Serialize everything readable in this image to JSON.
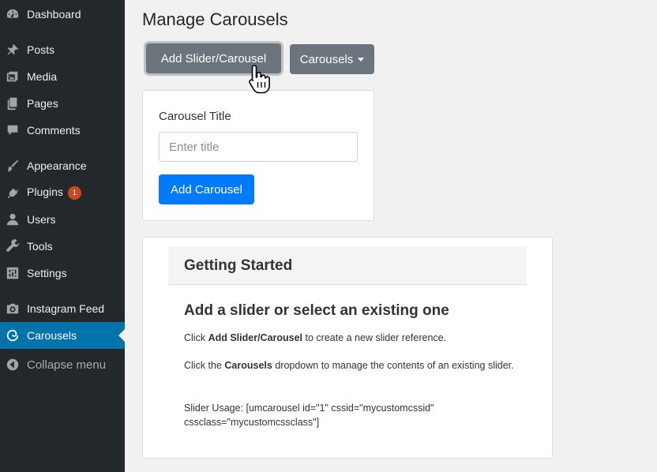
{
  "sidebar": {
    "items": [
      {
        "label": "Dashboard",
        "icon": "dashboard-icon"
      },
      {
        "label": "Posts",
        "icon": "pin-icon"
      },
      {
        "label": "Media",
        "icon": "media-icon"
      },
      {
        "label": "Pages",
        "icon": "pages-icon"
      },
      {
        "label": "Comments",
        "icon": "comment-icon"
      },
      {
        "label": "Appearance",
        "icon": "brush-icon"
      },
      {
        "label": "Plugins",
        "icon": "plug-icon",
        "badge": "1"
      },
      {
        "label": "Users",
        "icon": "user-icon"
      },
      {
        "label": "Tools",
        "icon": "wrench-icon"
      },
      {
        "label": "Settings",
        "icon": "settings-icon"
      },
      {
        "label": "Instagram Feed",
        "icon": "camera-icon"
      },
      {
        "label": "Carousels",
        "icon": "spiral-icon",
        "active": true
      }
    ],
    "collapse_label": "Collapse menu"
  },
  "main": {
    "title": "Manage Carousels",
    "add_slider_label": "Add Slider/Carousel",
    "carousels_dropdown_label": "Carousels",
    "form": {
      "label": "Carousel Title",
      "placeholder": "Enter title",
      "submit_label": "Add Carousel"
    },
    "help": {
      "header": "Getting Started",
      "subtitle": "Add a slider or select an existing one",
      "p1_pre": "Click ",
      "p1_bold": "Add Slider/Carousel",
      "p1_post": " to create a new slider reference.",
      "p2_pre": "Click the ",
      "p2_bold": "Carousels",
      "p2_post": " dropdown to manage the contents of an existing slider.",
      "usage": "Slider Usage: [umcarousel id=\"1\" cssid=\"mycustomcssid\" cssclass=\"mycustomcssclass\"]"
    }
  },
  "colors": {
    "sidebar_bg": "#23282d",
    "active_bg": "#0073aa",
    "secondary_btn": "#6c757d",
    "primary_btn": "#007bff",
    "badge": "#ca4a1f"
  }
}
